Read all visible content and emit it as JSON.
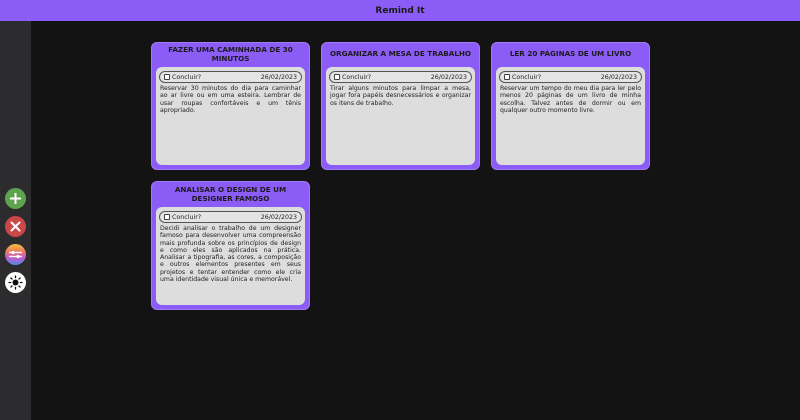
{
  "app": {
    "title": "Remind It"
  },
  "sidebar": {
    "buttons": [
      {
        "name": "add",
        "icon": "plus-icon",
        "color": "#5fa34f"
      },
      {
        "name": "delete",
        "icon": "close-icon",
        "color": "#c94848"
      },
      {
        "name": "filter",
        "icon": "filter-icon",
        "color": "#c45acf"
      },
      {
        "name": "theme",
        "icon": "sun-icon",
        "color": "#ffffff"
      }
    ]
  },
  "cards": [
    {
      "title": "FAZER UMA CAMINHADA DE 30 MINUTOS",
      "checkbox_label": "Concluir?",
      "date": "26/02/2023",
      "description": "Reservar 30 minutos do dia para caminhar ao ar livre ou em uma esteira. Lembrar de usar roupas confortáveis e um tênis apropriado."
    },
    {
      "title": "ORGANIZAR A MESA DE TRABALHO",
      "checkbox_label": "Concluir?",
      "date": "26/02/2023",
      "description": "Tirar alguns minutos para limpar a mesa, jogar fora papéis desnecessários e organizar os itens de trabalho."
    },
    {
      "title": "LER 20 PÁGINAS DE UM LIVRO",
      "checkbox_label": "Concluir?",
      "date": "26/02/2023",
      "description": "Reservar um tempo do meu dia para ler pelo menos 20 páginas de um livro de minha escolha. Talvez antes de dormir ou em qualquer outro momento livre."
    },
    {
      "title": "ANALISAR O DESIGN DE UM DESIGNER FAMOSO",
      "checkbox_label": "Concluir?",
      "date": "26/02/2023",
      "description": "Decidi analisar o trabalho de um designer famoso para desenvolver uma compreensão mais profunda sobre os princípios de design e como eles são aplicados na prática. Analisar a tipografia, as cores, a composição e outros elementos presentes em seus projetos e tentar entender como ele cria uma identidade visual única e memorável."
    }
  ],
  "theme": {
    "accent": "#8c5cf6",
    "background": "#141314",
    "sidebar": "#2c2c2e",
    "card_inner": "#dddddd"
  }
}
